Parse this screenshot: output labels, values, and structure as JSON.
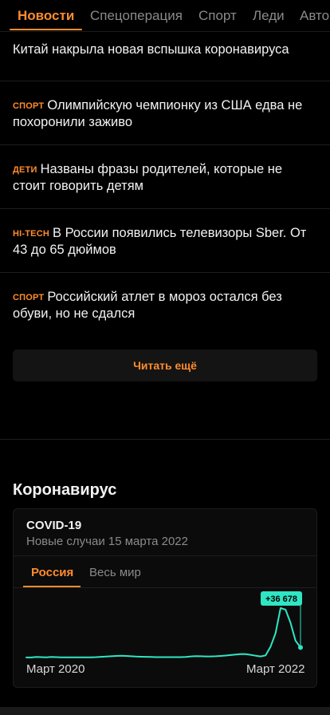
{
  "nav": {
    "tabs": [
      "Новости",
      "Спецоперация",
      "Спорт",
      "Леди",
      "Авто"
    ],
    "active_tab": "Новости"
  },
  "news": [
    {
      "rubric": "",
      "text": "Китай накрыла новая вспышка коронавируса"
    },
    {
      "rubric": "спорт",
      "text": "Олимпийскую чемпионку из США едва не похоронили заживо"
    },
    {
      "rubric": "дети",
      "text": "Названы фразы родителей, которые не стоит говорить детям"
    },
    {
      "rubric": "hi-tech",
      "text": "В России появились телевизоры Sber. От 43 до 65 дюймов"
    },
    {
      "rubric": "спорт",
      "text": "Российский атлет в мороз остался без обуви, но не сдался"
    }
  ],
  "read_more_label": "Читать ещё",
  "covid_section": {
    "title": "Коронавирус",
    "card_title": "COVID-19",
    "card_subtitle": "Новые случаи 15 марта 2022",
    "tabs": [
      "Россия",
      "Весь мир"
    ],
    "active_tab": "Россия"
  },
  "colors": {
    "accent": "#ff8c2e",
    "chart_line": "#2fe6c4",
    "background": "#000000"
  },
  "chart_data": {
    "type": "line",
    "title": "COVID-19",
    "x_start_label": "Март 2020",
    "x_end_label": "Март 2022",
    "last_value_label": "+36 678",
    "last_value": 36678,
    "grid": false,
    "series": [
      {
        "values": [
          3000,
          3000,
          4500,
          4000,
          3500,
          4500,
          4000,
          3500,
          3500,
          3500,
          3500,
          3500,
          3500,
          3500,
          4000,
          5000,
          6000,
          7000,
          8000,
          8500,
          8000,
          7000,
          6000,
          5500,
          5000,
          4500,
          4000,
          4000,
          4000,
          4000,
          4000,
          4000,
          4500,
          6500,
          7500,
          7000,
          6500,
          6500,
          7000,
          8000,
          9500,
          11000,
          13000,
          14500,
          14000,
          12000,
          9000,
          6500,
          10000,
          40000,
          85000,
          170000,
          165000,
          120000,
          60000,
          36678
        ]
      }
    ]
  }
}
